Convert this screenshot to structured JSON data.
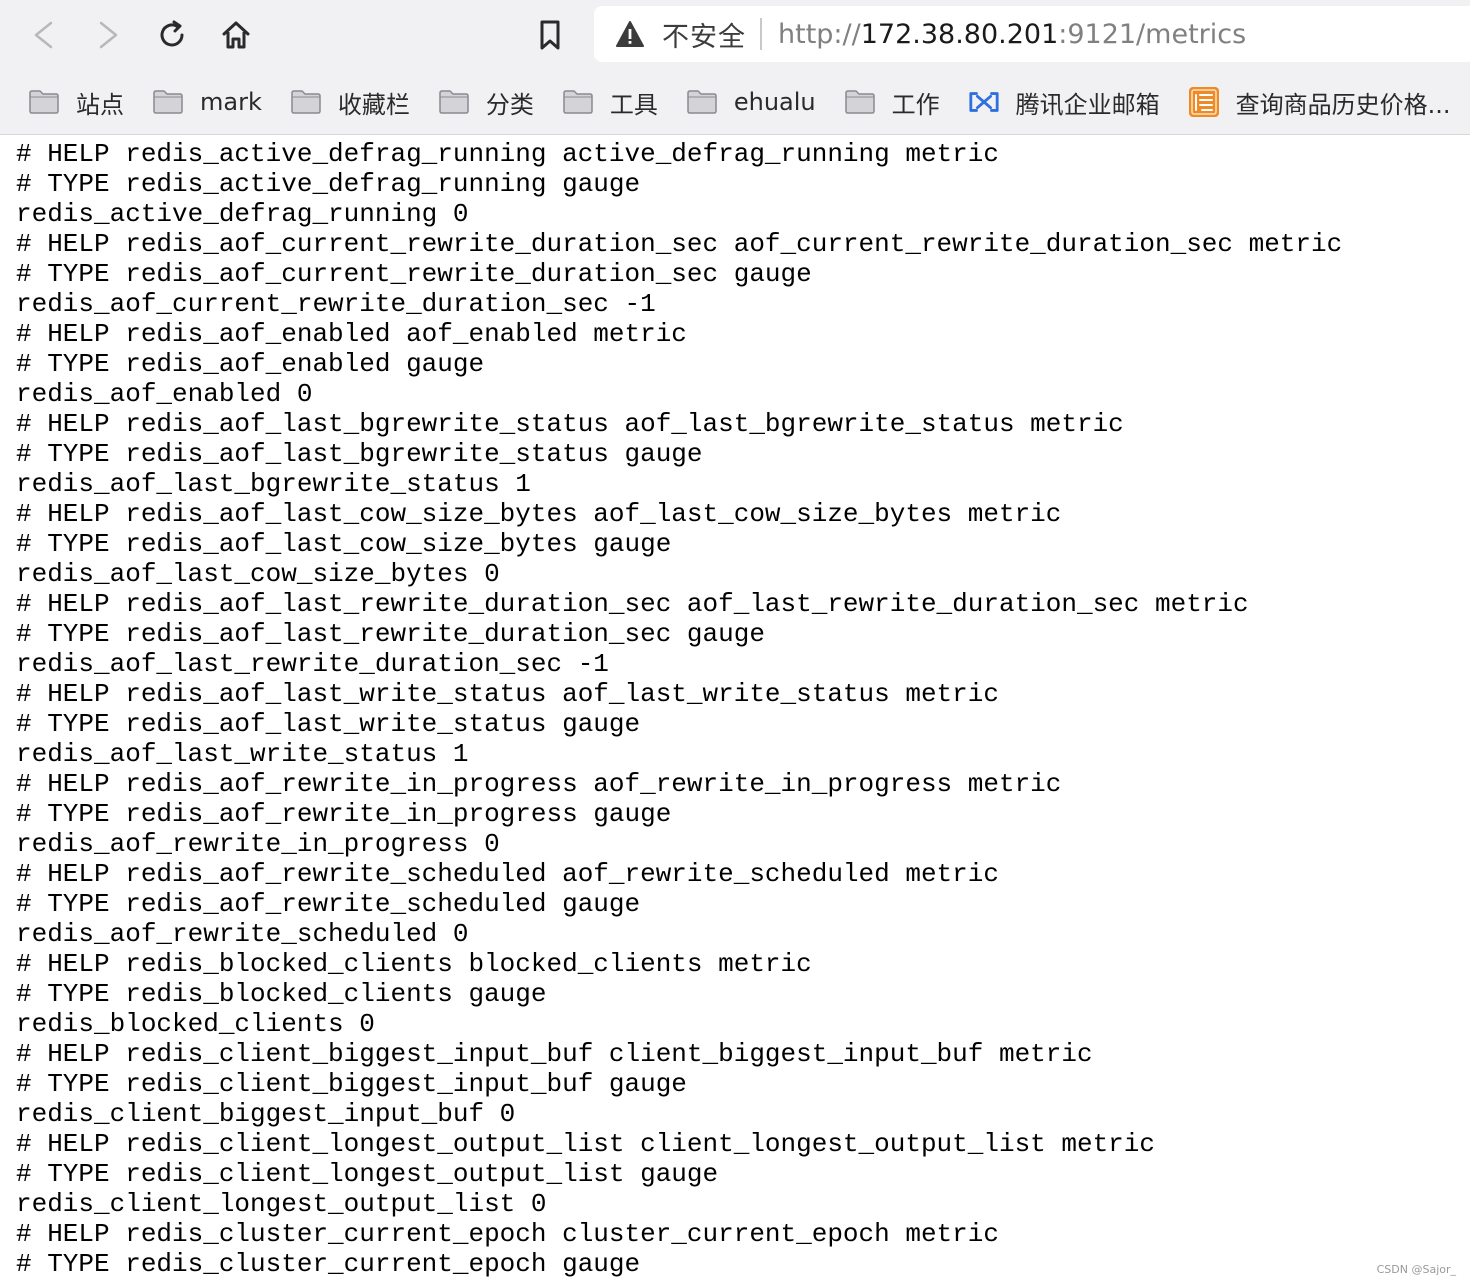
{
  "browser": {
    "security_label": "不安全",
    "url": {
      "scheme": "http://",
      "host": "172.38.80.201",
      "rest": ":9121/metrics"
    },
    "bookmarks": [
      {
        "label": "站点",
        "icon": "folder-icon"
      },
      {
        "label": "mark",
        "icon": "folder-icon"
      },
      {
        "label": "收藏栏",
        "icon": "folder-icon"
      },
      {
        "label": "分类",
        "icon": "folder-icon"
      },
      {
        "label": "工具",
        "icon": "folder-icon"
      },
      {
        "label": "ehualu",
        "icon": "folder-icon"
      },
      {
        "label": "工作",
        "icon": "folder-icon"
      },
      {
        "label": "腾讯企业邮箱",
        "icon": "tencent-mail-icon"
      },
      {
        "label": "查询商品历史价格...",
        "icon": "price-history-icon"
      }
    ]
  },
  "metrics_lines": [
    "# HELP redis_active_defrag_running active_defrag_running metric",
    "# TYPE redis_active_defrag_running gauge",
    "redis_active_defrag_running 0",
    "# HELP redis_aof_current_rewrite_duration_sec aof_current_rewrite_duration_sec metric",
    "# TYPE redis_aof_current_rewrite_duration_sec gauge",
    "redis_aof_current_rewrite_duration_sec -1",
    "# HELP redis_aof_enabled aof_enabled metric",
    "# TYPE redis_aof_enabled gauge",
    "redis_aof_enabled 0",
    "# HELP redis_aof_last_bgrewrite_status aof_last_bgrewrite_status metric",
    "# TYPE redis_aof_last_bgrewrite_status gauge",
    "redis_aof_last_bgrewrite_status 1",
    "# HELP redis_aof_last_cow_size_bytes aof_last_cow_size_bytes metric",
    "# TYPE redis_aof_last_cow_size_bytes gauge",
    "redis_aof_last_cow_size_bytes 0",
    "# HELP redis_aof_last_rewrite_duration_sec aof_last_rewrite_duration_sec metric",
    "# TYPE redis_aof_last_rewrite_duration_sec gauge",
    "redis_aof_last_rewrite_duration_sec -1",
    "# HELP redis_aof_last_write_status aof_last_write_status metric",
    "# TYPE redis_aof_last_write_status gauge",
    "redis_aof_last_write_status 1",
    "# HELP redis_aof_rewrite_in_progress aof_rewrite_in_progress metric",
    "# TYPE redis_aof_rewrite_in_progress gauge",
    "redis_aof_rewrite_in_progress 0",
    "# HELP redis_aof_rewrite_scheduled aof_rewrite_scheduled metric",
    "# TYPE redis_aof_rewrite_scheduled gauge",
    "redis_aof_rewrite_scheduled 0",
    "# HELP redis_blocked_clients blocked_clients metric",
    "# TYPE redis_blocked_clients gauge",
    "redis_blocked_clients 0",
    "# HELP redis_client_biggest_input_buf client_biggest_input_buf metric",
    "# TYPE redis_client_biggest_input_buf gauge",
    "redis_client_biggest_input_buf 0",
    "# HELP redis_client_longest_output_list client_longest_output_list metric",
    "# TYPE redis_client_longest_output_list gauge",
    "redis_client_longest_output_list 0",
    "# HELP redis_cluster_current_epoch cluster_current_epoch metric",
    "# TYPE redis_cluster_current_epoch gauge"
  ],
  "watermark": "CSDN @Sajor_"
}
